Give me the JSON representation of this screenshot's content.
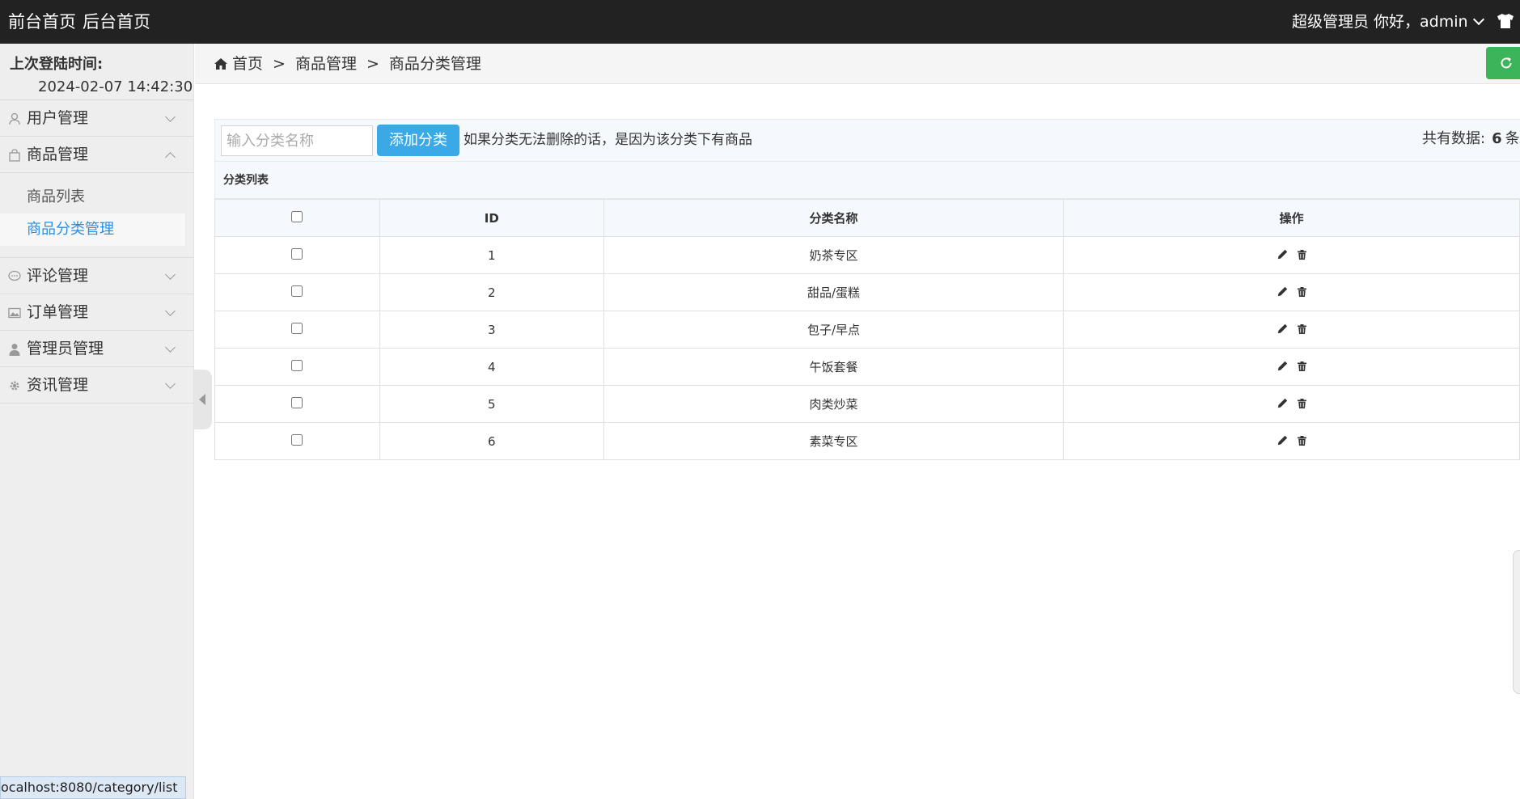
{
  "topbar": {
    "front_home": "前台首页",
    "back_home": "后台首页",
    "role": "超级管理员",
    "greeting": "你好，admin"
  },
  "sidebar": {
    "last_login_label": "上次登陆时间:",
    "last_login_value": "2024-02-07 14:42:30",
    "menus": [
      {
        "label": "用户管理",
        "icon": "user-icon"
      },
      {
        "label": "商品管理",
        "icon": "bag-icon"
      },
      {
        "label": "评论管理",
        "icon": "comment-icon"
      },
      {
        "label": "订单管理",
        "icon": "image-icon"
      },
      {
        "label": "管理员管理",
        "icon": "admin-icon"
      },
      {
        "label": "资讯管理",
        "icon": "gear-icon"
      }
    ],
    "sub_items": [
      "商品列表",
      "商品分类管理"
    ]
  },
  "status_url": "ocalhost:8080/category/list",
  "breadcrumb": {
    "home": "首页",
    "sep": ">",
    "level1": "商品管理",
    "level2": "商品分类管理"
  },
  "toolbar": {
    "search_placeholder": "输入分类名称",
    "add_label": "添加分类",
    "hint": "如果分类无法删除的话，是因为该分类下有商品",
    "total_label": "共有数据:",
    "total_count": "6",
    "total_unit": "条"
  },
  "table": {
    "caption": "分类列表",
    "headers": [
      "ID",
      "分类名称",
      "操作"
    ],
    "rows": [
      {
        "id": "1",
        "name": "奶茶专区"
      },
      {
        "id": "2",
        "name": "甜品/蛋糕"
      },
      {
        "id": "3",
        "name": "包子/早点"
      },
      {
        "id": "4",
        "name": "午饭套餐"
      },
      {
        "id": "5",
        "name": "肉类炒菜"
      },
      {
        "id": "6",
        "name": "素菜专区"
      }
    ]
  },
  "colors": {
    "topbar": "#222222",
    "accent_blue": "#3aa9e6",
    "active_link": "#2a8ee2",
    "refresh_green": "#3cb55a"
  }
}
